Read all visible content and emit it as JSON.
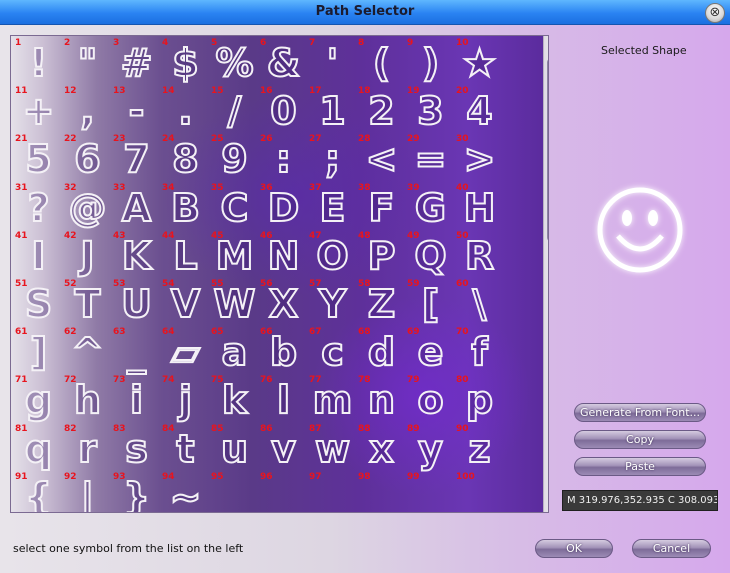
{
  "window": {
    "title": "Path Selector",
    "close_glyph": "⊗"
  },
  "glyphs": [
    {
      "n": "1",
      "s": "!"
    },
    {
      "n": "2",
      "s": "\""
    },
    {
      "n": "3",
      "s": "#"
    },
    {
      "n": "4",
      "s": "$"
    },
    {
      "n": "5",
      "s": "%"
    },
    {
      "n": "6",
      "s": "&"
    },
    {
      "n": "7",
      "s": "'"
    },
    {
      "n": "8",
      "s": "("
    },
    {
      "n": "9",
      "s": ")"
    },
    {
      "n": "10",
      "s": "★"
    },
    {
      "n": "11",
      "s": "+"
    },
    {
      "n": "12",
      "s": ","
    },
    {
      "n": "13",
      "s": "-"
    },
    {
      "n": "14",
      "s": "."
    },
    {
      "n": "15",
      "s": "/"
    },
    {
      "n": "16",
      "s": "0"
    },
    {
      "n": "17",
      "s": "1"
    },
    {
      "n": "18",
      "s": "2"
    },
    {
      "n": "19",
      "s": "3"
    },
    {
      "n": "20",
      "s": "4"
    },
    {
      "n": "21",
      "s": "5"
    },
    {
      "n": "22",
      "s": "6"
    },
    {
      "n": "23",
      "s": "7"
    },
    {
      "n": "24",
      "s": "8"
    },
    {
      "n": "25",
      "s": "9"
    },
    {
      "n": "26",
      "s": ":"
    },
    {
      "n": "27",
      "s": ";"
    },
    {
      "n": "28",
      "s": "<"
    },
    {
      "n": "29",
      "s": "="
    },
    {
      "n": "30",
      "s": ">"
    },
    {
      "n": "31",
      "s": "?"
    },
    {
      "n": "32",
      "s": "@"
    },
    {
      "n": "33",
      "s": "A"
    },
    {
      "n": "34",
      "s": "B"
    },
    {
      "n": "35",
      "s": "C"
    },
    {
      "n": "36",
      "s": "D"
    },
    {
      "n": "37",
      "s": "E"
    },
    {
      "n": "38",
      "s": "F"
    },
    {
      "n": "39",
      "s": "G"
    },
    {
      "n": "40",
      "s": "H"
    },
    {
      "n": "41",
      "s": "I"
    },
    {
      "n": "42",
      "s": "J"
    },
    {
      "n": "43",
      "s": "K"
    },
    {
      "n": "44",
      "s": "L"
    },
    {
      "n": "45",
      "s": "M"
    },
    {
      "n": "46",
      "s": "N"
    },
    {
      "n": "47",
      "s": "O"
    },
    {
      "n": "48",
      "s": "P"
    },
    {
      "n": "49",
      "s": "Q"
    },
    {
      "n": "50",
      "s": "R"
    },
    {
      "n": "51",
      "s": "S"
    },
    {
      "n": "52",
      "s": "T"
    },
    {
      "n": "53",
      "s": "U"
    },
    {
      "n": "54",
      "s": "V"
    },
    {
      "n": "55",
      "s": "W"
    },
    {
      "n": "56",
      "s": "X"
    },
    {
      "n": "57",
      "s": "Y"
    },
    {
      "n": "58",
      "s": "Z"
    },
    {
      "n": "59",
      "s": "["
    },
    {
      "n": "60",
      "s": "\\"
    },
    {
      "n": "61",
      "s": "]"
    },
    {
      "n": "62",
      "s": "^"
    },
    {
      "n": "63",
      "s": "_"
    },
    {
      "n": "64",
      "s": "▱"
    },
    {
      "n": "65",
      "s": "a"
    },
    {
      "n": "66",
      "s": "b"
    },
    {
      "n": "67",
      "s": "c"
    },
    {
      "n": "68",
      "s": "d"
    },
    {
      "n": "69",
      "s": "e"
    },
    {
      "n": "70",
      "s": "f"
    },
    {
      "n": "71",
      "s": "g"
    },
    {
      "n": "72",
      "s": "h"
    },
    {
      "n": "73",
      "s": "i"
    },
    {
      "n": "74",
      "s": "j"
    },
    {
      "n": "75",
      "s": "k"
    },
    {
      "n": "76",
      "s": "l"
    },
    {
      "n": "77",
      "s": "m"
    },
    {
      "n": "78",
      "s": "n"
    },
    {
      "n": "79",
      "s": "o"
    },
    {
      "n": "80",
      "s": "p"
    },
    {
      "n": "81",
      "s": "q"
    },
    {
      "n": "82",
      "s": "r"
    },
    {
      "n": "83",
      "s": "s"
    },
    {
      "n": "84",
      "s": "t"
    },
    {
      "n": "85",
      "s": "u"
    },
    {
      "n": "86",
      "s": "v"
    },
    {
      "n": "87",
      "s": "w"
    },
    {
      "n": "88",
      "s": "x"
    },
    {
      "n": "89",
      "s": "y"
    },
    {
      "n": "90",
      "s": "z"
    },
    {
      "n": "91",
      "s": "{"
    },
    {
      "n": "92",
      "s": "|"
    },
    {
      "n": "93",
      "s": "}"
    },
    {
      "n": "94",
      "s": "~"
    },
    {
      "n": "95",
      "s": ""
    },
    {
      "n": "96",
      "s": ""
    },
    {
      "n": "97",
      "s": ""
    },
    {
      "n": "98",
      "s": ""
    },
    {
      "n": "99",
      "s": ""
    },
    {
      "n": "100",
      "s": ""
    }
  ],
  "preview": {
    "label": "Selected Shape",
    "icon": "smiley-face-icon"
  },
  "buttons": {
    "generate": "Generate From Font...",
    "copy": "Copy",
    "paste": "Paste",
    "ok": "OK",
    "cancel": "Cancel"
  },
  "path_field": {
    "value": "M 319.976,352.935 C 308.093"
  },
  "status": {
    "text": "select one symbol from the list on the left"
  },
  "scrollbar": {
    "up_glyph": "▲",
    "down_glyph": "▼"
  },
  "colors": {
    "number_label": "#e8141e",
    "glyph_outline": "#f4f1f6",
    "title_bar": "#2a83f2",
    "accent_purple": "#6a36b4"
  }
}
